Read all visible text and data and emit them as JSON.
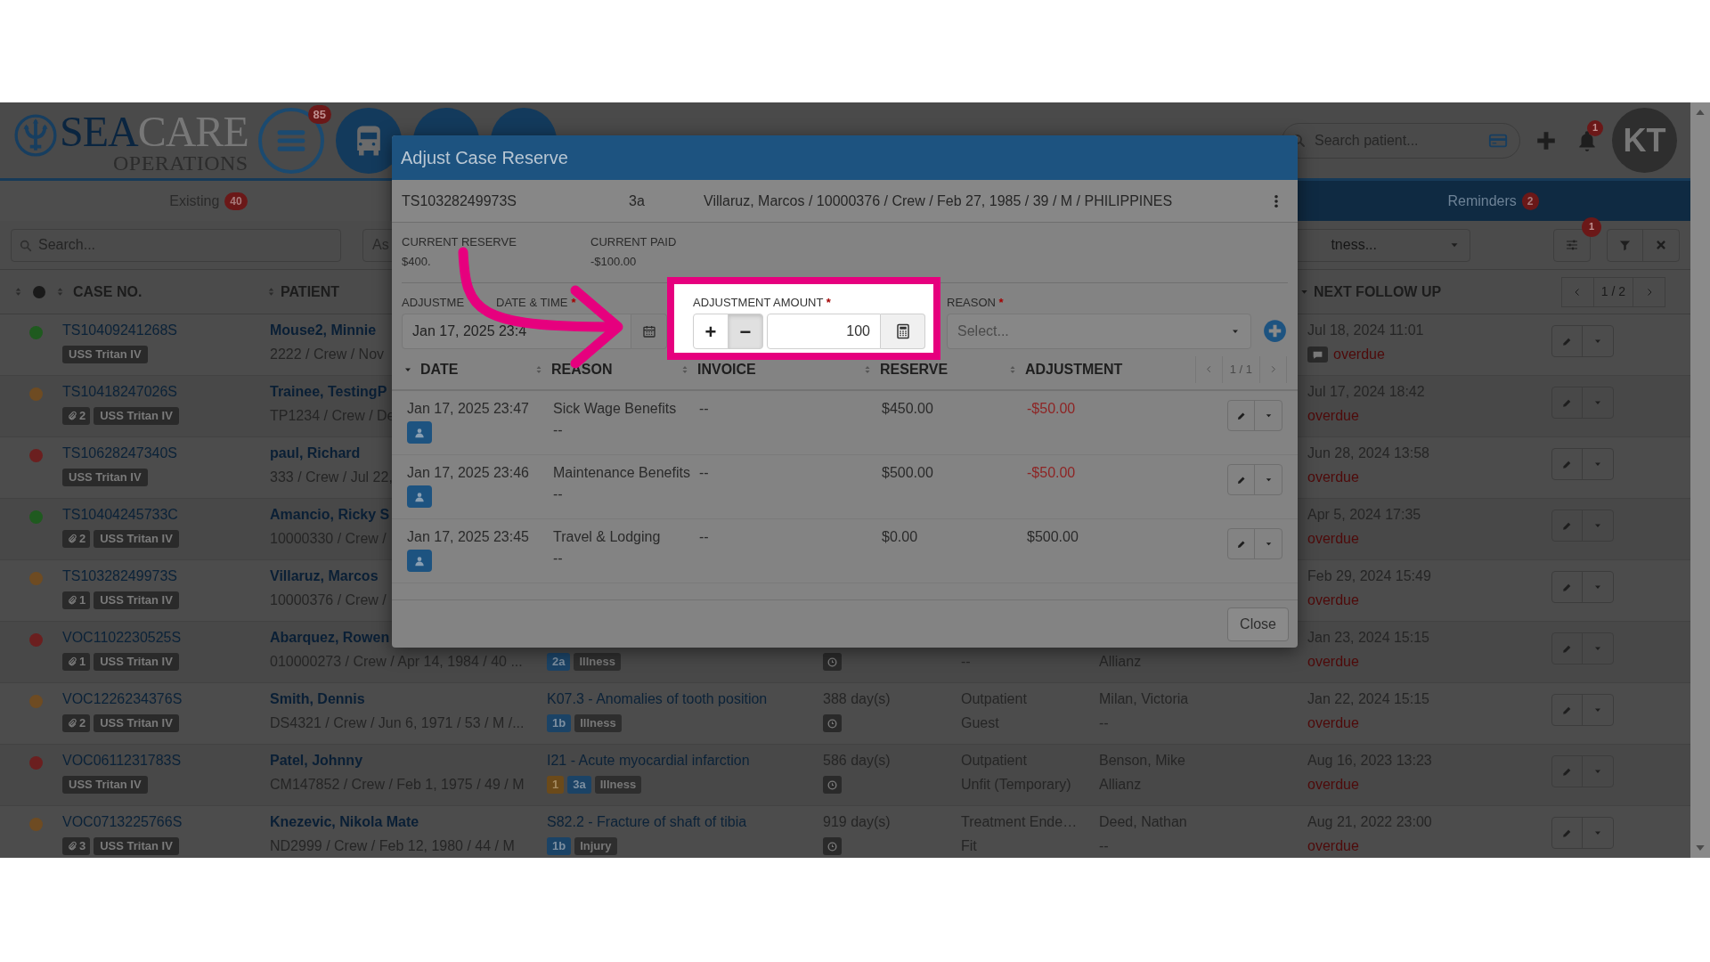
{
  "header": {
    "logo_primary": "SEA",
    "logo_secondary": "CARE",
    "logo_sub": "OPERATIONS",
    "menu_badge": "85",
    "search_placeholder": "Search patient...",
    "notification_badge": "1",
    "avatar": "KT"
  },
  "tabs": [
    {
      "label": "Existing",
      "count": "40",
      "selected": false
    },
    {
      "label": "Reminders",
      "count": "2",
      "selected": true
    }
  ],
  "filters": {
    "search_placeholder": "Search...",
    "select_1": "As",
    "select_2": "tness...",
    "settings_badge": "1"
  },
  "table": {
    "columns": [
      {
        "label": "CASE NO.",
        "sorted": false
      },
      {
        "label": "PATIENT",
        "sorted": false
      },
      {
        "label": "NEXT FOLLOW UP",
        "sorted": true
      }
    ],
    "pager": "1 / 2",
    "rows": [
      {
        "color": "#1f5a1f",
        "case_no": "TS10409241268S",
        "vessel": "USS Tritan IV",
        "patient_name": "Mouse2, Minnie",
        "patient_details": "2222 / Crew / Nov",
        "follow_up": "Jul 18, 2024 11:01",
        "has_note": true,
        "follow_up_status": "overdue"
      },
      {
        "color": "#6e4b22",
        "case_no": "TS10418247026S",
        "attachments": "2",
        "vessel": "USS Tritan IV",
        "patient_name": "Trainee, TestingP",
        "patient_details": "TP1234 / Crew / De",
        "follow_up": "Jul 17, 2024 18:42",
        "has_note": false,
        "follow_up_status": "overdue"
      },
      {
        "color": "#6b1f1f",
        "case_no": "TS10628247340S",
        "vessel": "USS Tritan IV",
        "patient_name": "paul, Richard",
        "patient_details": "333 / Crew / Jul 22,",
        "follow_up": "Jun 28, 2024 13:58",
        "has_note": false,
        "follow_up_status": "overdue"
      },
      {
        "color": "#1f5a1f",
        "case_no": "TS10404245733C",
        "attachments": "2",
        "vessel": "USS Tritan IV",
        "patient_name": "Amancio, Ricky S",
        "patient_details": "10000330 / Crew /",
        "follow_up": "Apr 5, 2024 17:35",
        "has_note": false,
        "follow_up_status": "overdue"
      },
      {
        "color": "#6e4b22",
        "case_no": "TS10328249973S",
        "attachments": "1",
        "vessel": "USS Tritan IV",
        "patient_name": "Villaruz, Marcos",
        "patient_details": "10000376 / Crew /",
        "follow_up": "Feb 29, 2024 15:49",
        "has_note": false,
        "follow_up_status": "overdue"
      },
      {
        "color": "#6b1f1f",
        "case_no": "VOC1102230525S",
        "attachments": "1",
        "vessel": "USS Tritan IV",
        "patient_name": "Abarquez, Rowen",
        "patient_details": "010000273 / Crew / Apr 14, 1984 / 40 ...",
        "diagnosis": {
          "badges": [
            {
              "label": "2a",
              "kind": "level"
            },
            {
              "label": "Illness",
              "kind": "category"
            }
          ]
        },
        "timer": true,
        "type": {
          "line_2": "--"
        },
        "person": {
          "line_2": "Allianz"
        },
        "follow_up": "Jan 23, 2024 15:15",
        "has_note": false,
        "follow_up_status": "overdue"
      },
      {
        "color": "#6e4b22",
        "case_no": "VOC1226234376S",
        "attachments": "2",
        "vessel": "USS Tritan IV",
        "patient_name": "Smith, Dennis",
        "patient_details": "DS4321 / Crew / Jun 6, 1971 / 53 / M /...",
        "diagnosis": {
          "title": "K07.3 - Anomalies of tooth position",
          "badges": [
            {
              "label": "1b",
              "kind": "level"
            },
            {
              "label": "Illness",
              "kind": "category"
            }
          ]
        },
        "days": "388 day(s)",
        "timer": true,
        "type": {
          "line_1": "Outpatient",
          "line_2": "Guest"
        },
        "person": {
          "line_1": "Milan, Victoria",
          "line_2": "--"
        },
        "follow_up": "Jan 22, 2024 15:15",
        "has_note": false,
        "follow_up_status": "overdue"
      },
      {
        "color": "#6b1f1f",
        "case_no": "VOC0611231783S",
        "vessel": "USS Tritan IV",
        "patient_name": "Patel, Johnny",
        "patient_details": "CM147852 / Crew / Feb 1, 1975 / 49 / M",
        "diagnosis": {
          "title": "I21 - Acute myocardial infarction",
          "badges": [
            {
              "label": "1",
              "kind": "alert"
            },
            {
              "label": "3a",
              "kind": "level"
            },
            {
              "label": "Illness",
              "kind": "category"
            }
          ]
        },
        "days": "586 day(s)",
        "timer": true,
        "type": {
          "line_1": "Outpatient",
          "line_2": "Unfit (Temporary)"
        },
        "person": {
          "line_1": "Benson, Mike",
          "line_2": "Allianz"
        },
        "follow_up": "Aug 16, 2023 13:23",
        "has_note": false,
        "follow_up_status": "overdue"
      },
      {
        "color": "#6e4b22",
        "case_no": "VOC0713225766S",
        "attachments": "3",
        "vessel": "USS Tritan IV",
        "patient_name": "Knezevic, Nikola Mate",
        "patient_details": "ND2999 / Crew / Feb 12, 1980 / 44 / M",
        "diagnosis": {
          "title": "S82.2 - Fracture of shaft of tibia",
          "badges": [
            {
              "label": "1b",
              "kind": "level"
            },
            {
              "label": "Injury",
              "kind": "category"
            }
          ]
        },
        "days": "919 day(s)",
        "timer": true,
        "type": {
          "line_1": "Treatment Ende…",
          "line_2": "Fit"
        },
        "person": {
          "line_1": "Deed, Nathan",
          "line_2": "--"
        },
        "follow_up": "Aug 21, 2022 23:00",
        "has_note": false,
        "follow_up_status": "overdue"
      }
    ]
  },
  "modal": {
    "title": "Adjust Case Reserve",
    "case_no": "TS10328249973S",
    "level": "3a",
    "patient": "Villaruz, Marcos / 10000376 / Crew / Feb 27, 1985 / 39 / M / PHILIPPINES",
    "summary": [
      {
        "label": "CURRENT RESERVE",
        "value": "$400."
      },
      {
        "label": "CURRENT PAID",
        "value": "-$100.00"
      }
    ],
    "date_field": {
      "label_parts": [
        "ADJUSTME",
        "DATE & TIME"
      ],
      "required_mark": "*",
      "value": "Jan 17, 2025 23:4"
    },
    "amount_field": {
      "label": "ADJUSTMENT AMOUNT",
      "required_mark": "*",
      "signs": [
        {
          "label": "+",
          "selected": false
        },
        {
          "label": "−",
          "selected": true
        }
      ],
      "value": "100"
    },
    "reason_field": {
      "label": "REASON",
      "required_mark": "*",
      "placeholder": "Select..."
    },
    "columns": [
      {
        "label": "DATE",
        "sorted": true
      },
      {
        "label": "REASON",
        "sorted": false
      },
      {
        "label": "INVOICE",
        "sorted": false
      },
      {
        "label": "RESERVE",
        "sorted": false
      },
      {
        "label": "ADJUSTMENT",
        "sorted": false
      }
    ],
    "pager": "1 / 1",
    "rows": [
      {
        "date": "Jan 17, 2025 23:47",
        "reason": "Sick Wage Benefits",
        "reason_note": "--",
        "invoice": "--",
        "reserve": "$450.00",
        "adjustment": "-$50.00",
        "negative": true
      },
      {
        "date": "Jan 17, 2025 23:46",
        "reason": "Maintenance Benefits",
        "reason_note": "--",
        "invoice": "--",
        "reserve": "$500.00",
        "adjustment": "-$50.00",
        "negative": true
      },
      {
        "date": "Jan 17, 2025 23:45",
        "reason": "Travel & Lodging",
        "reason_note": "--",
        "invoice": "--",
        "reserve": "$0.00",
        "adjustment": "$500.00",
        "negative": false
      }
    ],
    "close": "Close"
  }
}
